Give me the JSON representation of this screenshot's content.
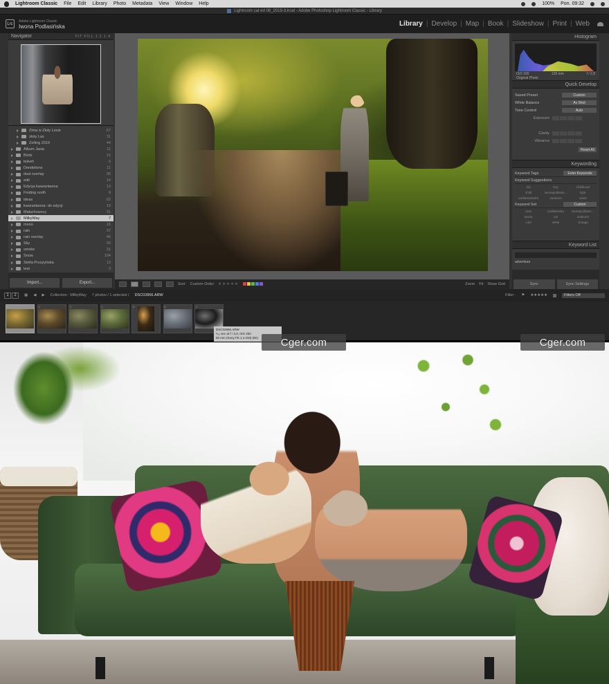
{
  "menubar": {
    "app": "Lightroom Classic",
    "items": [
      "File",
      "Edit",
      "Library",
      "Photo",
      "Metadata",
      "View",
      "Window",
      "Help"
    ],
    "battery": "100%",
    "clock": "Pon. 09:32"
  },
  "window": {
    "title": "Lightroom cat ed 08_2019-3.lrcat - Adobe Photoshop Lightroom Classic - Library"
  },
  "header": {
    "logo": "Lrc",
    "product": "Adobe Lightroom Classic",
    "user": "Iwona Podlasińska",
    "modules": [
      "Library",
      "Develop",
      "Map",
      "Book",
      "Slideshow",
      "Print",
      "Web"
    ],
    "active_module": "Library"
  },
  "navigator": {
    "title": "Navigator",
    "zoom_options": "FIT  FILL  1:1  1:4"
  },
  "folders": [
    {
      "name": "Zima w Złoty Lesie",
      "count": "67",
      "indent": true
    },
    {
      "name": "złoty Las",
      "count": "31",
      "indent": true
    },
    {
      "name": "Zolling 2019",
      "count": "44",
      "indent": true
    },
    {
      "name": "Album Jasia",
      "count": "11",
      "indent": false
    },
    {
      "name": "Birds",
      "count": "21",
      "indent": false
    },
    {
      "name": "bokeh",
      "count": "6",
      "indent": false
    },
    {
      "name": "Dendelions",
      "count": "11",
      "indent": false
    },
    {
      "name": "dust overlay",
      "count": "36",
      "indent": false
    },
    {
      "name": "edit",
      "count": "14",
      "indent": false
    },
    {
      "name": "Edycja kwarantanna",
      "count": "13",
      "indent": false
    },
    {
      "name": "Finding north",
      "count": "8",
      "indent": false
    },
    {
      "name": "ideas",
      "count": "62",
      "indent": false
    },
    {
      "name": "kwarantanna- do edycji",
      "count": "19",
      "indent": false
    },
    {
      "name": "Małuchowscy",
      "count": "31",
      "indent": false
    },
    {
      "name": "MilkyWay",
      "count": "7",
      "indent": false,
      "selected": true
    },
    {
      "name": "mono",
      "count": "15",
      "indent": false
    },
    {
      "name": "rain",
      "count": "37",
      "indent": false
    },
    {
      "name": "rain overlay",
      "count": "46",
      "indent": false
    },
    {
      "name": "Sky",
      "count": "93",
      "indent": false
    },
    {
      "name": "smoke",
      "count": "31",
      "indent": false
    },
    {
      "name": "Snow",
      "count": "104",
      "indent": false
    },
    {
      "name": "Stella Pruszyńska",
      "count": "13",
      "indent": false
    },
    {
      "name": "test",
      "count": "3",
      "indent": false
    }
  ],
  "left_buttons": {
    "import": "Import...",
    "export": "Export..."
  },
  "toolbar": {
    "sort_label": "Sort:",
    "sort_value": "Custom Order",
    "zoom_label": "Zoom",
    "fit_label": "Fit",
    "show_grid": "Show Grid"
  },
  "histogram": {
    "title": "Histogram",
    "iso": "ISO 100",
    "focal": "135 mm",
    "aperture": "f / 2,8",
    "original_photo": "Original Photo"
  },
  "quick_develop": {
    "title": "Quick Develop",
    "saved_preset_label": "Saved Preset",
    "saved_preset_value": "Custom",
    "white_balance_label": "White Balance",
    "white_balance_value": "As Shot",
    "tone_control_label": "Tone Control",
    "tone_control_value": "Auto",
    "exposure_label": "Exposure",
    "clarity_label": "Clarity",
    "vibrance_label": "Vibrance",
    "reset_all": "Reset All"
  },
  "keywording": {
    "title": "Keywording",
    "keyword_tags_label": "Keyword Tags",
    "keyword_tags_value": "Enter Keywords",
    "suggestions_label": "Keyword Suggestions",
    "suggestions": [
      "kid",
      "boy",
      "childhood",
      "child",
      "iwonapodlasin...",
      "light",
      "podlasinskafot",
      "outdoors",
      "same"
    ],
    "keyword_set_label": "Keyword Set",
    "keyword_set_value": "Custom",
    "set_items": [
      "view",
      "podlasinska",
      "iwonapodlasin...",
      "iwona",
      "car",
      "outdoors",
      "cold",
      "white",
      "vintage"
    ]
  },
  "keyword_list": {
    "title": "Keyword List",
    "item": "adventure"
  },
  "sync": {
    "sync": "Sync",
    "sync_settings": "Sync Settings"
  },
  "filmstrip_bar": {
    "pages": [
      "1",
      "2"
    ],
    "collection": "Collection : MilkyWay",
    "count": "7 photos / 1 selected /",
    "filename": "DSC02866.ARW",
    "filter_label": "Filter :",
    "filter_value": "Filters Off"
  },
  "thumbnails": [
    {
      "idx": "1",
      "selected": true,
      "tall": false,
      "colors": [
        "#7a6a32",
        "#c9a046",
        "#3b3520"
      ]
    },
    {
      "idx": "2",
      "selected": false,
      "tall": false,
      "colors": [
        "#5c4a2a",
        "#a88b4e",
        "#2c2418"
      ]
    },
    {
      "idx": "3",
      "selected": false,
      "tall": false,
      "colors": [
        "#57593d",
        "#8a8a62",
        "#2c2a1e"
      ]
    },
    {
      "idx": "4",
      "selected": false,
      "tall": false,
      "colors": [
        "#5c6a3a",
        "#9aa268",
        "#2e321e"
      ]
    },
    {
      "idx": "5",
      "selected": false,
      "tall": true,
      "colors": [
        "#3a2a18",
        "#d9a04a",
        "#1c140c"
      ]
    },
    {
      "idx": "6",
      "selected": false,
      "tall": false,
      "colors": [
        "#6a7078",
        "#9aa0a8",
        "#3a3e44"
      ]
    },
    {
      "idx": "7",
      "selected": false,
      "tall": false,
      "colors": [
        "#1c1c1c",
        "#6e6e70",
        "#c9c9c9"
      ]
    }
  ],
  "tooltip": {
    "line1": "DSC02866.ARW",
    "line2": "¹⁄₅₀ sec at f / 2,0, ISO 250",
    "line3": "50 mm (Sony FE 1.4 GM) (8K)"
  },
  "watermark": {
    "text": "Cger.com"
  },
  "colors": {
    "panel_bg": "#313131",
    "header_bg": "#1e1e1e",
    "active_text": "#e6e6e6",
    "sofa_green": "#3f5c36",
    "label_swatches": [
      "#d94040",
      "#e2c64a",
      "#64b441",
      "#4d7fd9",
      "#8a5bc7"
    ]
  }
}
